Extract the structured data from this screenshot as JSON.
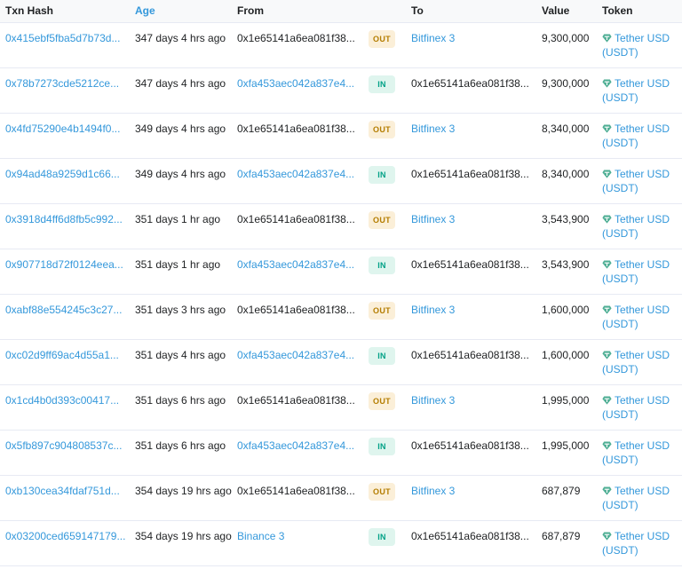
{
  "headers": {
    "hash": "Txn Hash",
    "age": "Age",
    "from": "From",
    "to": "To",
    "value": "Value",
    "token": "Token"
  },
  "token_icon": "tether-gem-icon",
  "colors": {
    "link": "#3498db",
    "out_badge_bg": "#fbefd8",
    "out_badge_fg": "#b47d00",
    "in_badge_bg": "#dff5ee",
    "in_badge_fg": "#00a186",
    "tether_green": "#50af95"
  },
  "rows": [
    {
      "hash": "0x415ebf5fba5d7b73d...",
      "age": "347 days 4 hrs ago",
      "from": "0x1e65141a6ea081f38...",
      "from_link": false,
      "dir": "OUT",
      "to": "Bitfinex 3",
      "to_link": true,
      "value": "9,300,000",
      "token": "Tether USD",
      "token_sym": "(USDT)"
    },
    {
      "hash": "0x78b7273cde5212ce...",
      "age": "347 days 4 hrs ago",
      "from": "0xfa453aec042a837e4...",
      "from_link": true,
      "dir": "IN",
      "to": "0x1e65141a6ea081f38...",
      "to_link": false,
      "value": "9,300,000",
      "token": "Tether USD",
      "token_sym": "(USDT)"
    },
    {
      "hash": "0x4fd75290e4b1494f0...",
      "age": "349 days 4 hrs ago",
      "from": "0x1e65141a6ea081f38...",
      "from_link": false,
      "dir": "OUT",
      "to": "Bitfinex 3",
      "to_link": true,
      "value": "8,340,000",
      "token": "Tether USD",
      "token_sym": "(USDT)"
    },
    {
      "hash": "0x94ad48a9259d1c66...",
      "age": "349 days 4 hrs ago",
      "from": "0xfa453aec042a837e4...",
      "from_link": true,
      "dir": "IN",
      "to": "0x1e65141a6ea081f38...",
      "to_link": false,
      "value": "8,340,000",
      "token": "Tether USD",
      "token_sym": "(USDT)"
    },
    {
      "hash": "0x3918d4ff6d8fb5c992...",
      "age": "351 days 1 hr ago",
      "from": "0x1e65141a6ea081f38...",
      "from_link": false,
      "dir": "OUT",
      "to": "Bitfinex 3",
      "to_link": true,
      "value": "3,543,900",
      "token": "Tether USD",
      "token_sym": "(USDT)"
    },
    {
      "hash": "0x907718d72f0124eea...",
      "age": "351 days 1 hr ago",
      "from": "0xfa453aec042a837e4...",
      "from_link": true,
      "dir": "IN",
      "to": "0x1e65141a6ea081f38...",
      "to_link": false,
      "value": "3,543,900",
      "token": "Tether USD",
      "token_sym": "(USDT)"
    },
    {
      "hash": "0xabf88e554245c3c27...",
      "age": "351 days 3 hrs ago",
      "from": "0x1e65141a6ea081f38...",
      "from_link": false,
      "dir": "OUT",
      "to": "Bitfinex 3",
      "to_link": true,
      "value": "1,600,000",
      "token": "Tether USD",
      "token_sym": "(USDT)"
    },
    {
      "hash": "0xc02d9ff69ac4d55a1...",
      "age": "351 days 4 hrs ago",
      "from": "0xfa453aec042a837e4...",
      "from_link": true,
      "dir": "IN",
      "to": "0x1e65141a6ea081f38...",
      "to_link": false,
      "value": "1,600,000",
      "token": "Tether USD",
      "token_sym": "(USDT)"
    },
    {
      "hash": "0x1cd4b0d393c00417...",
      "age": "351 days 6 hrs ago",
      "from": "0x1e65141a6ea081f38...",
      "from_link": false,
      "dir": "OUT",
      "to": "Bitfinex 3",
      "to_link": true,
      "value": "1,995,000",
      "token": "Tether USD",
      "token_sym": "(USDT)"
    },
    {
      "hash": "0x5fb897c904808537c...",
      "age": "351 days 6 hrs ago",
      "from": "0xfa453aec042a837e4...",
      "from_link": true,
      "dir": "IN",
      "to": "0x1e65141a6ea081f38...",
      "to_link": false,
      "value": "1,995,000",
      "token": "Tether USD",
      "token_sym": "(USDT)"
    },
    {
      "hash": "0xb130cea34fdaf751d...",
      "age": "354 days 19 hrs ago",
      "from": "0x1e65141a6ea081f38...",
      "from_link": false,
      "dir": "OUT",
      "to": "Bitfinex 3",
      "to_link": true,
      "value": "687,879",
      "token": "Tether USD",
      "token_sym": "(USDT)"
    },
    {
      "hash": "0x03200ced659147179...",
      "age": "354 days 19 hrs ago",
      "from": "Binance 3",
      "from_link": true,
      "dir": "IN",
      "to": "0x1e65141a6ea081f38...",
      "to_link": false,
      "value": "687,879",
      "token": "Tether USD",
      "token_sym": "(USDT)"
    }
  ]
}
